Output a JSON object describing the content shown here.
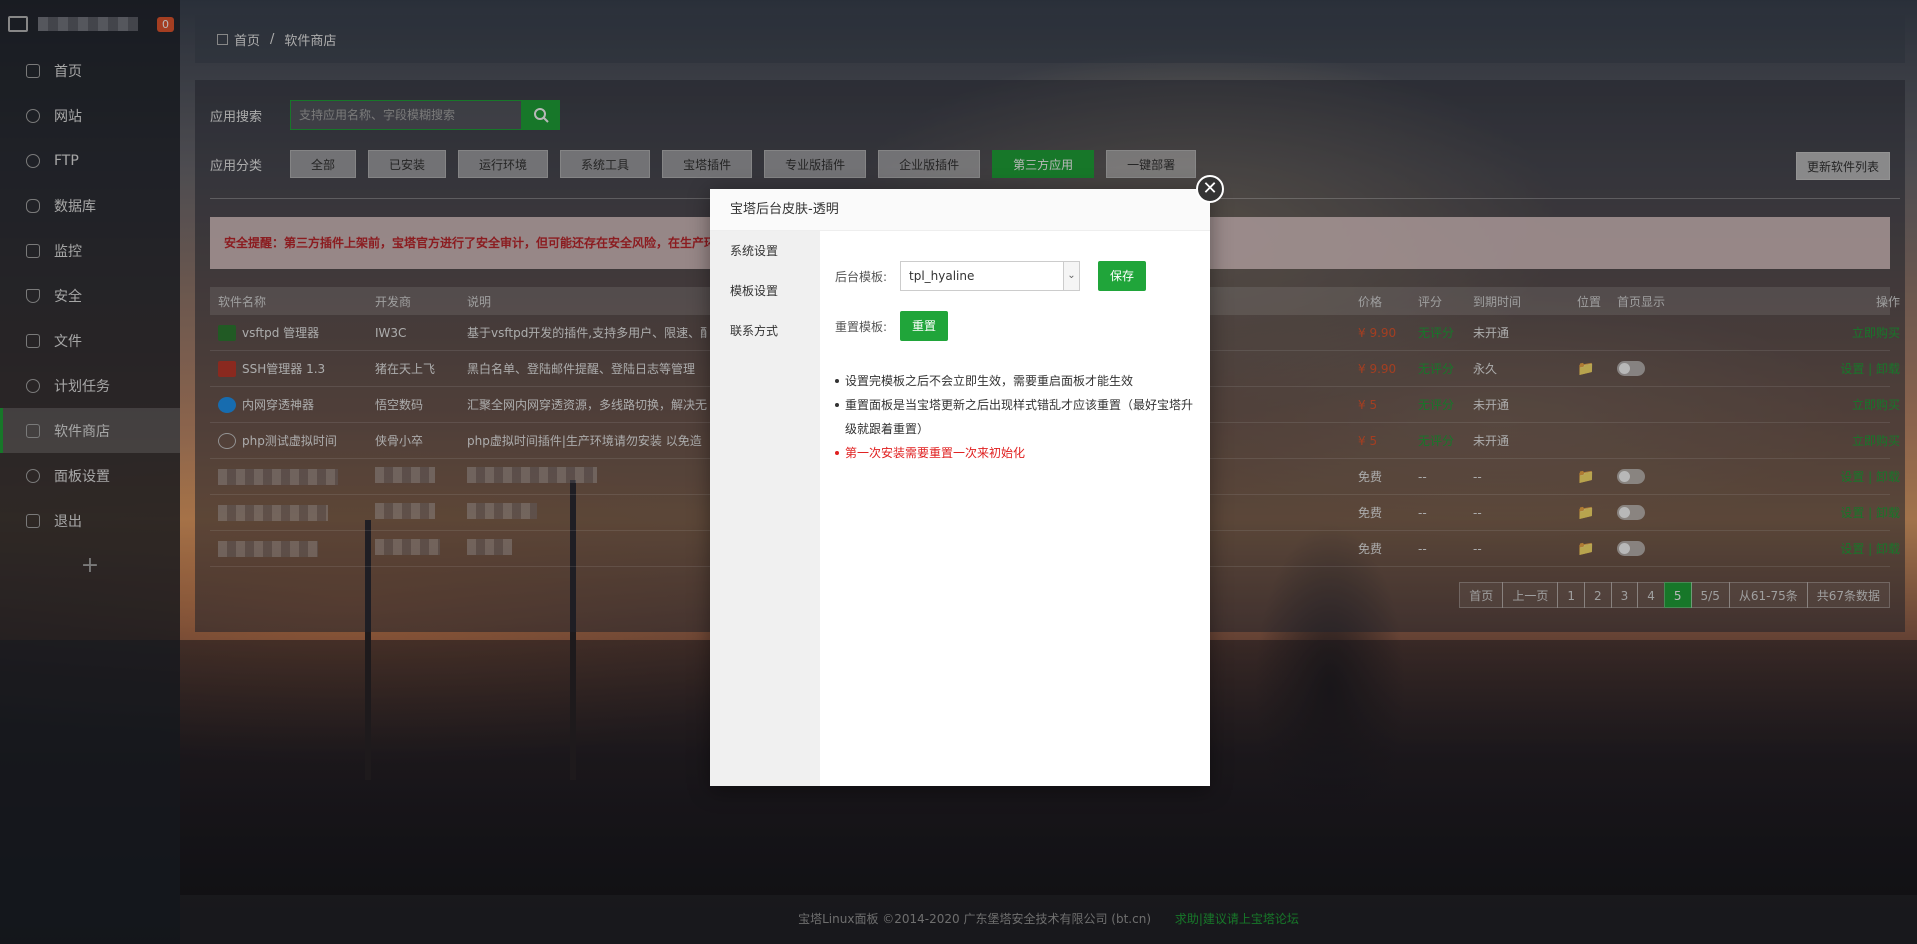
{
  "sidebar": {
    "badge": "0",
    "items": [
      {
        "label": "首页",
        "icon": "home-icon"
      },
      {
        "label": "网站",
        "icon": "globe-icon"
      },
      {
        "label": "FTP",
        "icon": "ftp-icon"
      },
      {
        "label": "数据库",
        "icon": "database-icon"
      },
      {
        "label": "监控",
        "icon": "monitor-icon"
      },
      {
        "label": "安全",
        "icon": "shield-icon"
      },
      {
        "label": "文件",
        "icon": "file-icon"
      },
      {
        "label": "计划任务",
        "icon": "clock-icon"
      },
      {
        "label": "软件商店",
        "icon": "grid-icon"
      },
      {
        "label": "面板设置",
        "icon": "gear-icon"
      },
      {
        "label": "退出",
        "icon": "logout-icon"
      }
    ],
    "add": "+"
  },
  "breadcrumb": {
    "home": "首页",
    "sep": "/",
    "current": "软件商店"
  },
  "search": {
    "label": "应用搜索",
    "placeholder": "支持应用名称、字段模糊搜索"
  },
  "category": {
    "label": "应用分类",
    "buttons": [
      "全部",
      "已安装",
      "运行环境",
      "系统工具",
      "宝塔插件",
      "专业版插件",
      "企业版插件",
      "第三方应用",
      "一键部署"
    ],
    "update": "更新软件列表"
  },
  "warning": "安全提醒：第三方插件上架前，宝塔官方进行了安全审计，但可能还存在安全风险，在生产环",
  "table": {
    "headers": {
      "name": "软件名称",
      "dev": "开发商",
      "desc": "说明",
      "price": "价格",
      "rate": "评分",
      "expire": "到期时间",
      "loc": "位置",
      "home": "首页显示",
      "op": "操作"
    },
    "rows": [
      {
        "name": "vsftpd 管理器",
        "dev": "IW3C",
        "desc": "基于vsftpd开发的插件,支持多用户、限速、配",
        "price": "¥ 9.90",
        "rate": "无评分",
        "expire": "未开通",
        "op": "立即购买"
      },
      {
        "name": "SSH管理器 1.3",
        "dev": "猪在天上飞",
        "desc": "黑白名单、登陆邮件提醒、登陆日志等管理",
        "price": "¥ 9.90",
        "rate": "无评分",
        "expire": "永久",
        "op": "设置 | 卸载"
      },
      {
        "name": "内网穿透神器",
        "dev": "悟空数码",
        "desc": "汇聚全网内网穿透资源，多线路切换，解决无",
        "price": "¥ 5",
        "rate": "无评分",
        "expire": "未开通",
        "op": "立即购买"
      },
      {
        "name": "php测试虚拟时间",
        "dev": "侠骨小卒",
        "desc": "php虚拟时间插件|生产环境请勿安装 以免造",
        "price": "¥ 5",
        "rate": "无评分",
        "expire": "未开通",
        "op": "立即购买"
      },
      {
        "price": "免费",
        "rate": "--",
        "expire": "--",
        "op": "设置 | 卸载"
      },
      {
        "price": "免费",
        "rate": "--",
        "expire": "--",
        "op": "设置 | 卸载"
      },
      {
        "price": "免费",
        "rate": "--",
        "expire": "--",
        "op": "设置 | 卸载"
      }
    ]
  },
  "pager": {
    "first": "首页",
    "prev": "上一页",
    "pages": [
      "1",
      "2",
      "3",
      "4",
      "5"
    ],
    "current": "5",
    "fraction": "5/5",
    "range": "从61-75条",
    "total": "共67条数据"
  },
  "footer": {
    "copyright": "宝塔Linux面板 ©2014-2020 广东堡塔安全技术有限公司 (bt.cn)",
    "link": "求助|建议请上宝塔论坛"
  },
  "modal": {
    "title": "宝塔后台皮肤-透明",
    "menu": [
      "系统设置",
      "模板设置",
      "联系方式"
    ],
    "template_label": "后台模板:",
    "template_value": "tpl_hyaline",
    "save": "保存",
    "reset_label": "重置模板:",
    "reset": "重置",
    "tips": [
      "设置完模板之后不会立即生效，需要重启面板才能生效",
      "重置面板是当宝塔更新之后出现样式错乱才应该重置（最好宝塔升级就跟着重置）"
    ],
    "tip_red": "第一次安装需要重置一次来初始化"
  },
  "colors": {
    "accent": "#20a53a",
    "warning": "#c1272d",
    "badge": "#e4572e"
  }
}
